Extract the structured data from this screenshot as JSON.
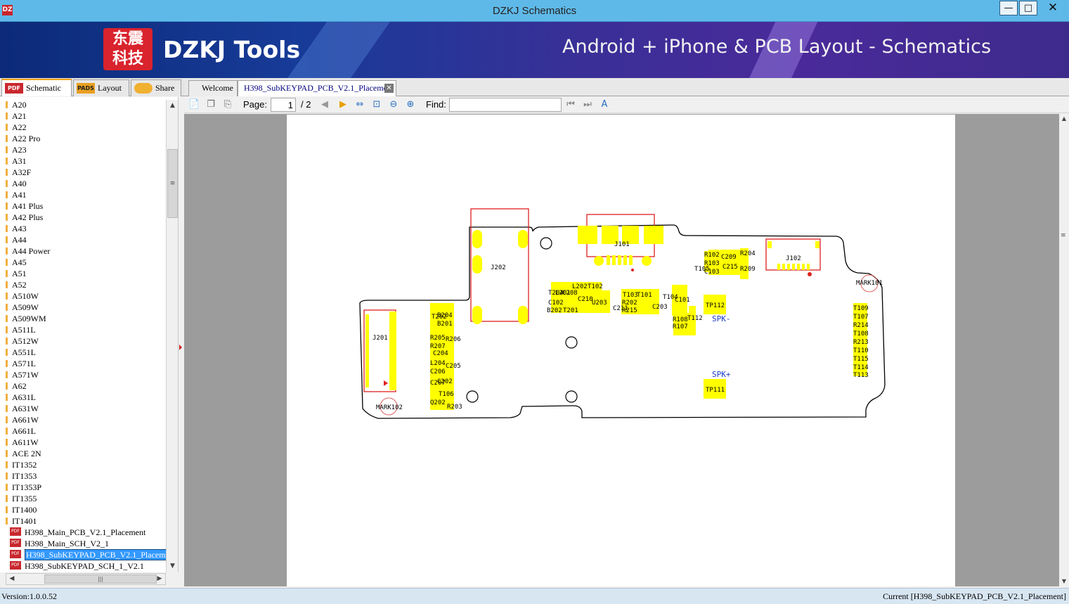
{
  "window": {
    "title": "DZKJ Schematics",
    "app_icon": "DZ",
    "min": "—",
    "max": "□",
    "close": "✕"
  },
  "banner": {
    "logo_line1": "东震",
    "logo_line2": "科技",
    "brand": "DZKJ Tools",
    "slogan": "Android + iPhone & PCB Layout - Schematics"
  },
  "left_tabs": [
    {
      "label": "Schematic",
      "icon": "PDF",
      "active": true
    },
    {
      "label": "Layout",
      "icon": "PADS"
    },
    {
      "label": "Share",
      "icon": "cloud-icon"
    }
  ],
  "doc_tabs": [
    {
      "label": "Welcome"
    },
    {
      "label": "H398_SubKEYPAD_PCB_V2.1_Placement",
      "active": true
    }
  ],
  "tree": {
    "folders": [
      "A20",
      "A21",
      "A22",
      "A22 Pro",
      "A23",
      "A31",
      "A32F",
      "A40",
      "A41",
      "A41 Plus",
      "A42 Plus",
      "A43",
      "A44",
      "A44 Power",
      "A45",
      "A51",
      "A52",
      "A510W",
      "A509W",
      "A509WM",
      "A511L",
      "A512W",
      "A551L",
      "A571L",
      "A571W",
      "A62",
      "A631L",
      "A631W",
      "A661W",
      "A661L",
      "A611W",
      "ACE 2N",
      "IT1352",
      "IT1353",
      "IT1353P",
      "IT1355",
      "IT1400",
      "IT1401"
    ],
    "files": [
      "H398_Main_PCB_V2.1_Placement",
      "H398_Main_SCH_V2_1",
      "H398_SubKEYPAD_PCB_V2.1_Placement",
      "H398_SubKEYPAD_SCH_1_V2.1"
    ],
    "selected_file": "H398_SubKEYPAD_PCB_V2.1_Placement",
    "pdf_icon": "PDF"
  },
  "toolbar": {
    "page_label": "Page:",
    "page_value": "1",
    "page_total": "/ 2",
    "find_label": "Find:",
    "find_value": ""
  },
  "pcb": {
    "labels": [
      {
        "t": "J202"
      },
      {
        "t": "J101"
      },
      {
        "t": "J102"
      },
      {
        "t": "J201"
      },
      {
        "t": "MARK101"
      },
      {
        "t": "MARK102"
      },
      {
        "t": "TP112"
      },
      {
        "t": "TP111"
      },
      {
        "t": "SPK-"
      },
      {
        "t": "SPK+"
      },
      {
        "t": "C209"
      },
      {
        "t": "C215"
      },
      {
        "t": "C103"
      },
      {
        "t": "R102"
      },
      {
        "t": "R103"
      },
      {
        "t": "R204"
      },
      {
        "t": "R209"
      },
      {
        "t": "T105"
      },
      {
        "t": "L202"
      },
      {
        "t": "T102"
      },
      {
        "t": "C208"
      },
      {
        "t": "C210"
      },
      {
        "t": "L201"
      },
      {
        "t": "T204"
      },
      {
        "t": "C102"
      },
      {
        "t": "B202"
      },
      {
        "t": "T201"
      },
      {
        "t": "U203"
      },
      {
        "t": "T103"
      },
      {
        "t": "T101"
      },
      {
        "t": "R202"
      },
      {
        "t": "R215"
      },
      {
        "t": "C211"
      },
      {
        "t": "C203"
      },
      {
        "t": "T104"
      },
      {
        "t": "C101"
      },
      {
        "t": "R108"
      },
      {
        "t": "R107"
      },
      {
        "t": "T112"
      },
      {
        "t": "T202"
      },
      {
        "t": "B204"
      },
      {
        "t": "B201"
      },
      {
        "t": "R206"
      },
      {
        "t": "R205"
      },
      {
        "t": "R207"
      },
      {
        "t": "C204"
      },
      {
        "t": "L204"
      },
      {
        "t": "C205"
      },
      {
        "t": "C206"
      },
      {
        "t": "C207"
      },
      {
        "t": "C202"
      },
      {
        "t": "T106"
      },
      {
        "t": "Q202"
      },
      {
        "t": "R203"
      },
      {
        "t": "T109"
      },
      {
        "t": "T107"
      },
      {
        "t": "R214"
      },
      {
        "t": "T108"
      },
      {
        "t": "R213"
      },
      {
        "t": "T110"
      },
      {
        "t": "T115"
      },
      {
        "t": "T114"
      },
      {
        "t": "T113"
      }
    ]
  },
  "status": {
    "version": "Version:1.0.0.52",
    "current": "Current [H398_SubKEYPAD_PCB_V2.1_Placement]"
  },
  "colors": {
    "titlebar": "#5fb9e8",
    "selection": "#3399ff",
    "pad": "#ffff00",
    "outline": "#e02020",
    "label_blue": "#1a3cc8"
  }
}
